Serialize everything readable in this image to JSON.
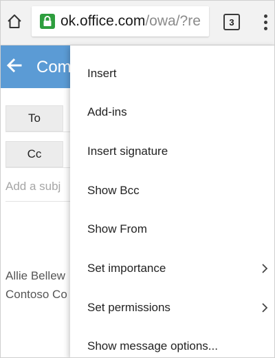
{
  "browser": {
    "url_host": "ok.office.com",
    "url_path": "/owa/?re",
    "tab_count": "3"
  },
  "compose": {
    "title": "Com",
    "to_label": "To",
    "cc_label": "Cc",
    "subject_placeholder": "Add a subj",
    "signature_name": "Allie Bellew",
    "signature_company": "Contoso Co"
  },
  "menu": {
    "items": [
      {
        "label": "Insert",
        "submenu": false
      },
      {
        "label": "Add-ins",
        "submenu": false
      },
      {
        "label": "Insert signature",
        "submenu": false
      },
      {
        "label": "Show Bcc",
        "submenu": false
      },
      {
        "label": "Show From",
        "submenu": false
      },
      {
        "label": "Set importance",
        "submenu": true
      },
      {
        "label": "Set permissions",
        "submenu": true
      },
      {
        "label": "Show message options...",
        "submenu": false
      }
    ]
  },
  "colors": {
    "header_blue": "#5b9bd5",
    "lock_green": "#2e9e3e"
  }
}
